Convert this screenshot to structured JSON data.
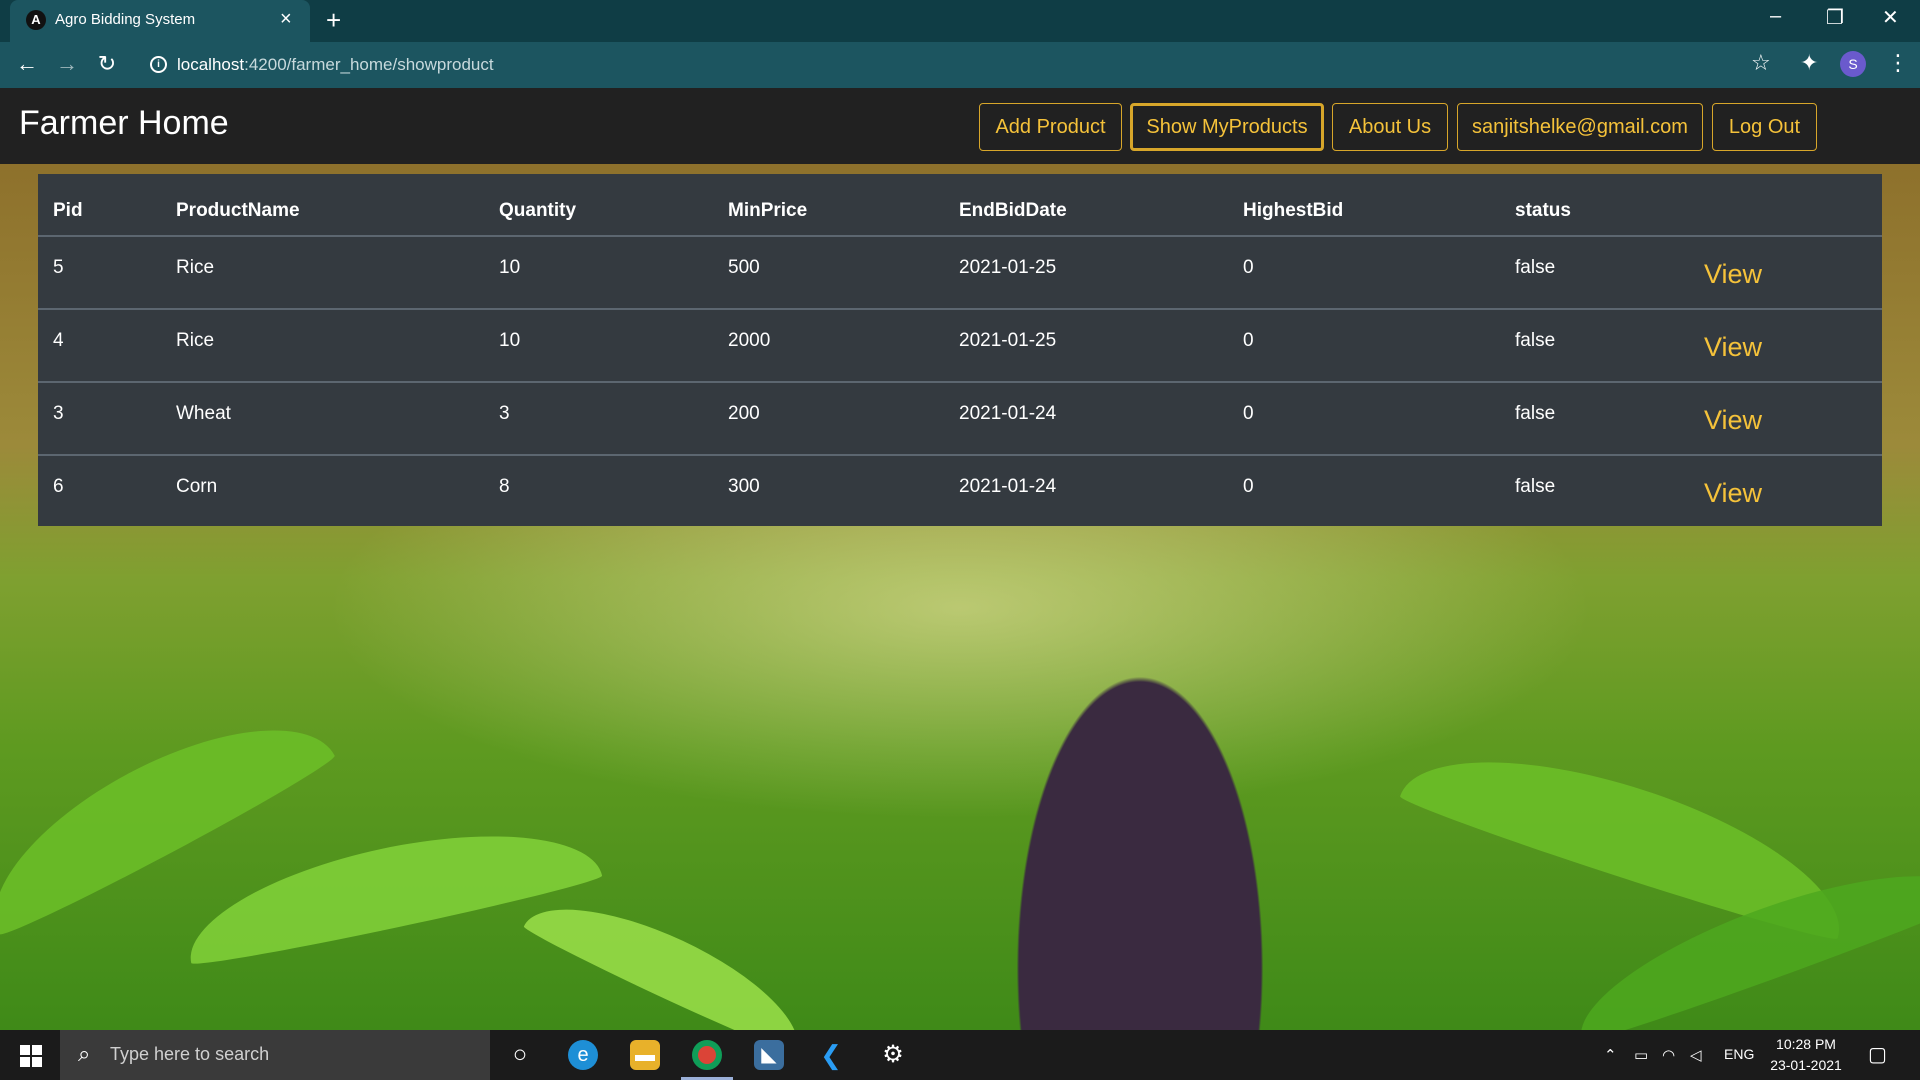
{
  "browser": {
    "tab_title": "Agro Bidding System",
    "tab_favicon_letter": "A",
    "url_host": "localhost",
    "url_path": ":4200/farmer_home/showproduct",
    "profile_initial": "S"
  },
  "navbar": {
    "brand": "Farmer Home",
    "buttons": [
      "Add Product",
      "Show MyProducts",
      "About Us",
      "sanjitshelke@gmail.com",
      "Log Out"
    ],
    "active_index": 1,
    "accent_color": "#f5c23a"
  },
  "table": {
    "headers": [
      "Pid",
      "ProductName",
      "Quantity",
      "MinPrice",
      "EndBidDate",
      "HighestBid",
      "status"
    ],
    "rows": [
      {
        "pid": "5",
        "name": "Rice",
        "qty": "10",
        "min_price": "500",
        "end_date": "2021-01-25",
        "highest_bid": "0",
        "status": "false",
        "action": "View"
      },
      {
        "pid": "4",
        "name": "Rice",
        "qty": "10",
        "min_price": "2000",
        "end_date": "2021-01-25",
        "highest_bid": "0",
        "status": "false",
        "action": "View"
      },
      {
        "pid": "3",
        "name": "Wheat",
        "qty": "3",
        "min_price": "200",
        "end_date": "2021-01-24",
        "highest_bid": "0",
        "status": "false",
        "action": "View"
      },
      {
        "pid": "6",
        "name": "Corn",
        "qty": "8",
        "min_price": "300",
        "end_date": "2021-01-24",
        "highest_bid": "0",
        "status": "false",
        "action": "View"
      }
    ]
  },
  "taskbar": {
    "search_placeholder": "Type here to search",
    "language": "ENG",
    "time": "10:28 PM",
    "date": "23-01-2021"
  },
  "icons": {
    "back": "back-arrow-icon",
    "forward": "forward-arrow-icon",
    "reload": "reload-icon",
    "star": "star-icon",
    "extensions": "puzzle-icon",
    "menu": "kebab-menu-icon"
  }
}
